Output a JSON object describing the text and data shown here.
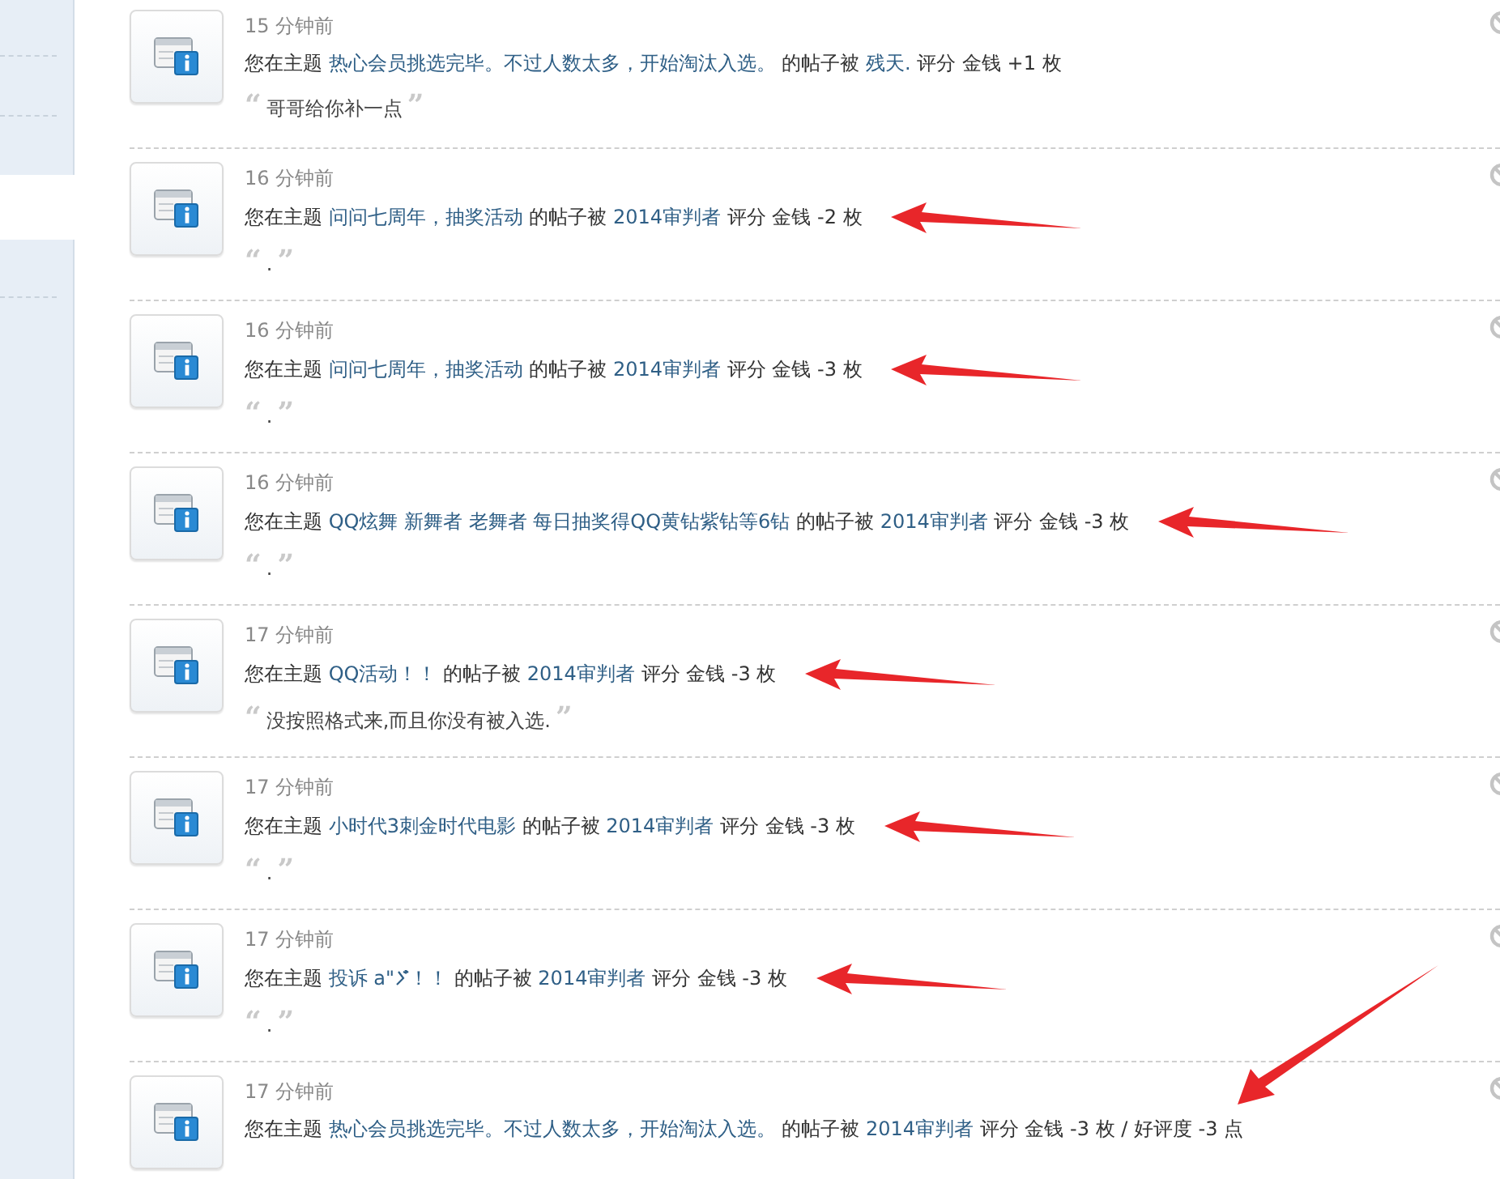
{
  "notices": [
    {
      "time": "15 分钟前",
      "prefix": "您在主题",
      "topic": "热心会员挑选完毕。不过人数太多，开始淘汰入选。",
      "middle": "的帖子被",
      "user": "残天.",
      "rating": "评分 金钱 +1 枚",
      "quote": {
        "open": "“",
        "text": "哥哥给你补一点",
        "close": "”"
      },
      "kind": "plain"
    },
    {
      "time": "16 分钟前",
      "prefix": "您在主题",
      "topic": "问问七周年，抽奖活动",
      "middle": "的帖子被",
      "user": "2014审判者",
      "rating": "评分 金钱 -2 枚",
      "quote": {
        "open": "“",
        "text": ".",
        "close": "”"
      },
      "kind": "arrow"
    },
    {
      "time": "16 分钟前",
      "prefix": "您在主题",
      "topic": "问问七周年，抽奖活动",
      "middle": "的帖子被",
      "user": "2014审判者",
      "rating": "评分 金钱 -3 枚",
      "quote": {
        "open": "“",
        "text": ".",
        "close": "”"
      },
      "kind": "arrow"
    },
    {
      "time": "16 分钟前",
      "prefix": "您在主题",
      "topic": "QQ炫舞 新舞者 老舞者 每日抽奖得QQ黄钻紫钻等6钻",
      "middle": "的帖子被",
      "user": "2014审判者",
      "rating": "评分 金钱 -3 枚",
      "quote": {
        "open": "“",
        "text": ".",
        "close": "”"
      },
      "kind": "arrow"
    },
    {
      "time": "17 分钟前",
      "prefix": "您在主题",
      "topic": "QQ活动！！",
      "middle": "的帖子被",
      "user": "2014审判者",
      "rating": "评分 金钱 -3 枚",
      "quote": {
        "open": "“",
        "text": "没按照格式来,而且你没有被入选.",
        "close": "”"
      },
      "kind": "arrow"
    },
    {
      "time": "17 分钟前",
      "prefix": "您在主题",
      "topic": "小时代3刺金时代电影",
      "middle": "的帖子被",
      "user": "2014审判者",
      "rating": "评分 金钱 -3 枚",
      "quote": {
        "open": "“",
        "text": ".",
        "close": "”"
      },
      "kind": "arrow"
    },
    {
      "time": "17 分钟前",
      "prefix": "您在主题",
      "topic": "投诉 a\"",
      "topic_glyph": true,
      "topic_end": "！！",
      "middle": "的帖子被",
      "user": "2014审判者",
      "rating": "评分 金钱 -3 枚",
      "quote": {
        "open": "“",
        "text": ".",
        "close": "”"
      },
      "kind": "arrow"
    },
    {
      "time": "17 分钟前",
      "prefix": "您在主题",
      "topic": "热心会员挑选完毕。不过人数太多，开始淘汰入选。",
      "middle": "的帖子被",
      "user": "2014审判者",
      "rating": "评分 金钱 -3 枚 / 好评度 -3 点",
      "kind": "diagonal"
    }
  ]
}
